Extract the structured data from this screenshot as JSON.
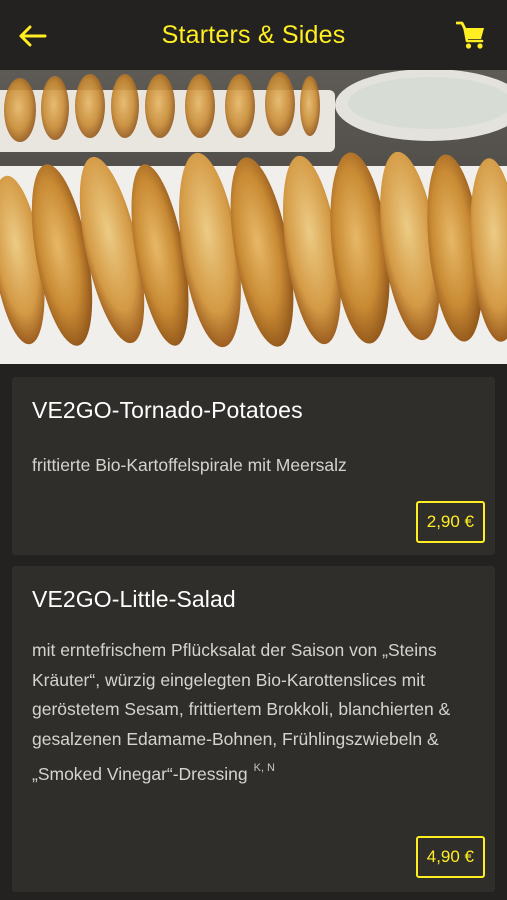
{
  "header": {
    "title": "Starters & Sides",
    "back_icon": "arrow-left-icon",
    "cart_icon": "shopping-cart-icon"
  },
  "colors": {
    "accent": "#ffee22",
    "background": "#232220",
    "card": "#2f2e2b"
  },
  "hero": {
    "image": "tornado-potatoes-photo"
  },
  "items": [
    {
      "name": "VE2GO-Tornado-Potatoes",
      "description": "frittierte Bio-Kartoffelspirale mit Meersalz",
      "allergens": "",
      "price": "2,90 €"
    },
    {
      "name": "VE2GO-Little-Salad",
      "description": "mit erntefrischem Pflücksalat der Saison von „Steins Kräuter“, würzig eingelegten Bio-Karottenslices mit geröstetem Sesam, frittiertem Brokkoli, blanchierten & gesalzenen Edamame-Bohnen, Frühlingszwiebeln & „Smoked Vinegar“-Dressing",
      "allergens": "K, N",
      "price": "4,90 €"
    }
  ]
}
